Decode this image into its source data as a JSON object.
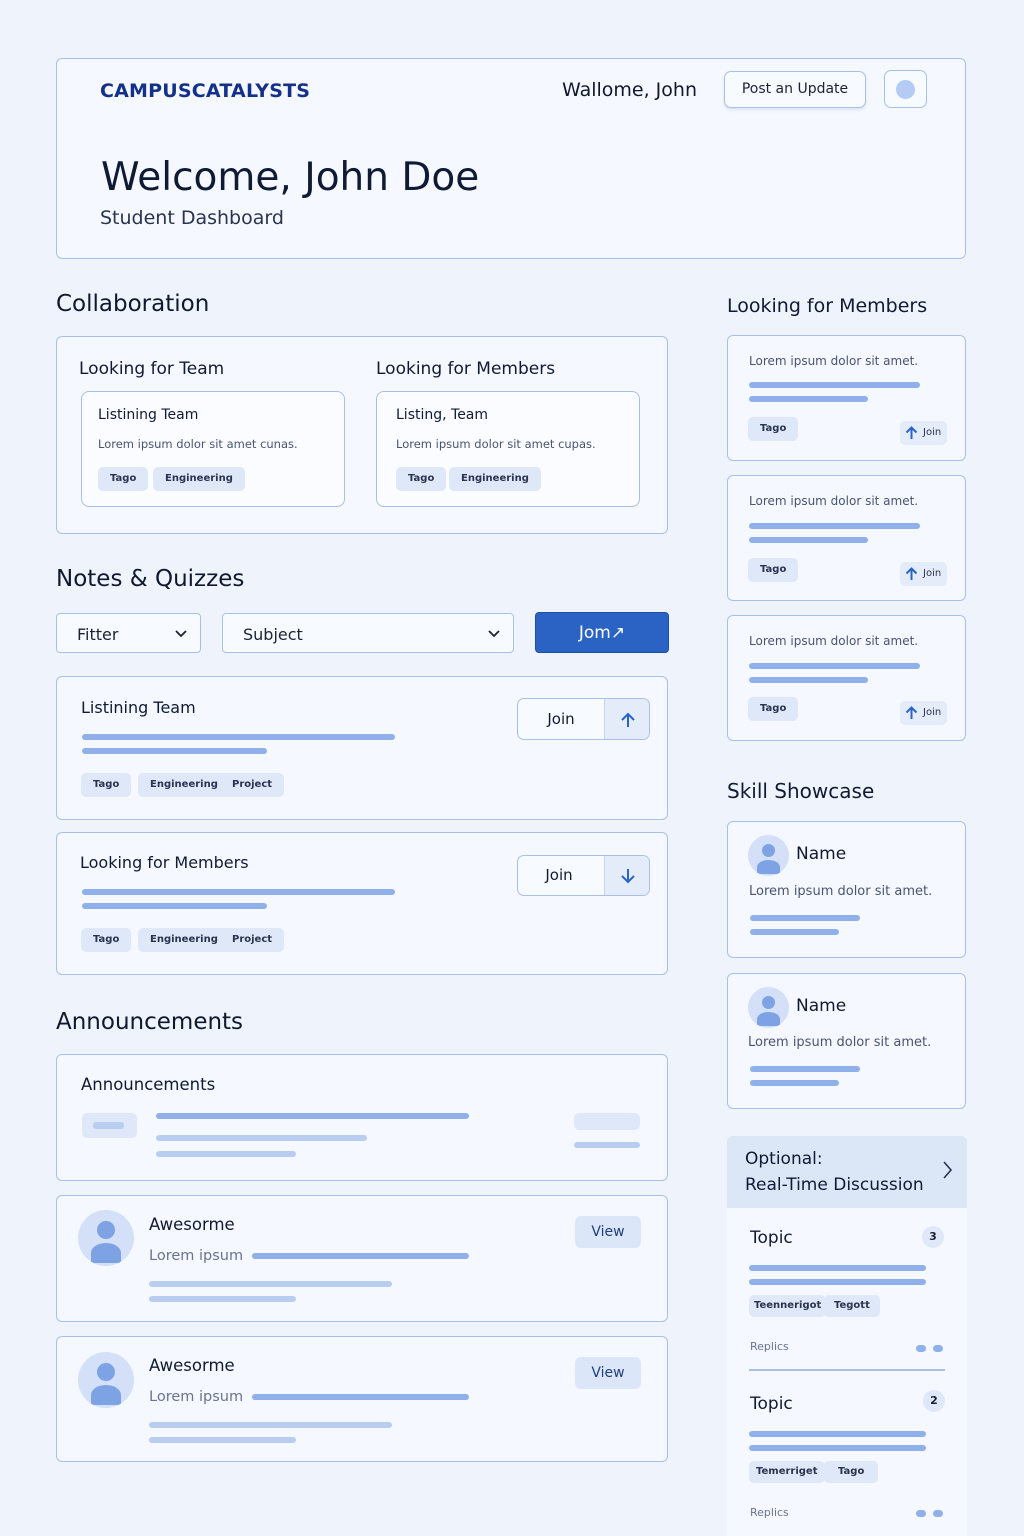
{
  "header": {
    "brand": "CAMPUSCATALYSTS",
    "greeting": "Wallome, John",
    "post_update_label": "Post an Update",
    "title": "Welcome, John Doe",
    "subtitle": "Student Dashboard"
  },
  "collaboration": {
    "heading": "Collaboration",
    "columns": [
      {
        "heading": "Looking for Team",
        "card_title": "Listining Team",
        "card_text": "Lorem ipsum dolor sit amet cunas.",
        "tags": [
          "Tago",
          "Engineering"
        ]
      },
      {
        "heading": "Looking for Members",
        "card_title": "Listing, Team",
        "card_text": "Lorem ipsum dolor sit amet cupas.",
        "tags": [
          "Tago",
          "Engineering"
        ]
      }
    ]
  },
  "notes": {
    "heading": "Notes & Quizzes",
    "filter_label": "Fitter",
    "subject_label": "Subject",
    "action_label": "Jom↗",
    "items": [
      {
        "title": "Listining Team",
        "join_label": "Join",
        "tags": [
          "Tago",
          "Engineering",
          "Project"
        ],
        "arrow": "up-arrow-icon"
      },
      {
        "title": "Looking for Members",
        "join_label": "Join",
        "tags": [
          "Tago",
          "Engineering",
          "Project"
        ],
        "arrow": "down-arrow-icon"
      }
    ]
  },
  "announcements": {
    "heading": "Announcements",
    "card_title": "Announcements",
    "posts": [
      {
        "name": "Awesorme",
        "text": "Lorem ipsum",
        "view_label": "View"
      },
      {
        "name": "Awesorme",
        "text": "Lorem ipsum",
        "view_label": "View"
      }
    ]
  },
  "members_sidebar": {
    "heading": "Looking for Members",
    "cards": [
      {
        "text": "Lorem ipsum dolor sit amet.",
        "tag": "Tago",
        "join_label": "Join"
      },
      {
        "text": "Lorem ipsum dolor sit amet.",
        "tag": "Tago",
        "join_label": "Join"
      },
      {
        "text": "Lorem ipsum dolor sit amet.",
        "tag": "Tago",
        "join_label": "Join"
      }
    ]
  },
  "skills": {
    "heading": "Skill Showcase",
    "cards": [
      {
        "name": "Name",
        "text": "Lorem ipsum dolor sit amet."
      },
      {
        "name": "Name",
        "text": "Lorem ipsum dolor sit amet."
      }
    ]
  },
  "discussion": {
    "title_line1": "Optional:",
    "title_line2": "Real-Time Discussion",
    "topics": [
      {
        "title": "Topic",
        "count": "3",
        "tags": [
          "Teennerigot",
          "Tegott"
        ],
        "replies_label": "Replics"
      },
      {
        "title": "Topic",
        "count": "2",
        "tags": [
          "Temerriget",
          "Tago"
        ],
        "replies_label": "Replics"
      }
    ]
  },
  "colors": {
    "background": "#eef3fc",
    "card_border": "#a9c0e6",
    "accent": "#2b63c4",
    "brand_text": "#14318a",
    "bar": "#8fb0ea"
  }
}
